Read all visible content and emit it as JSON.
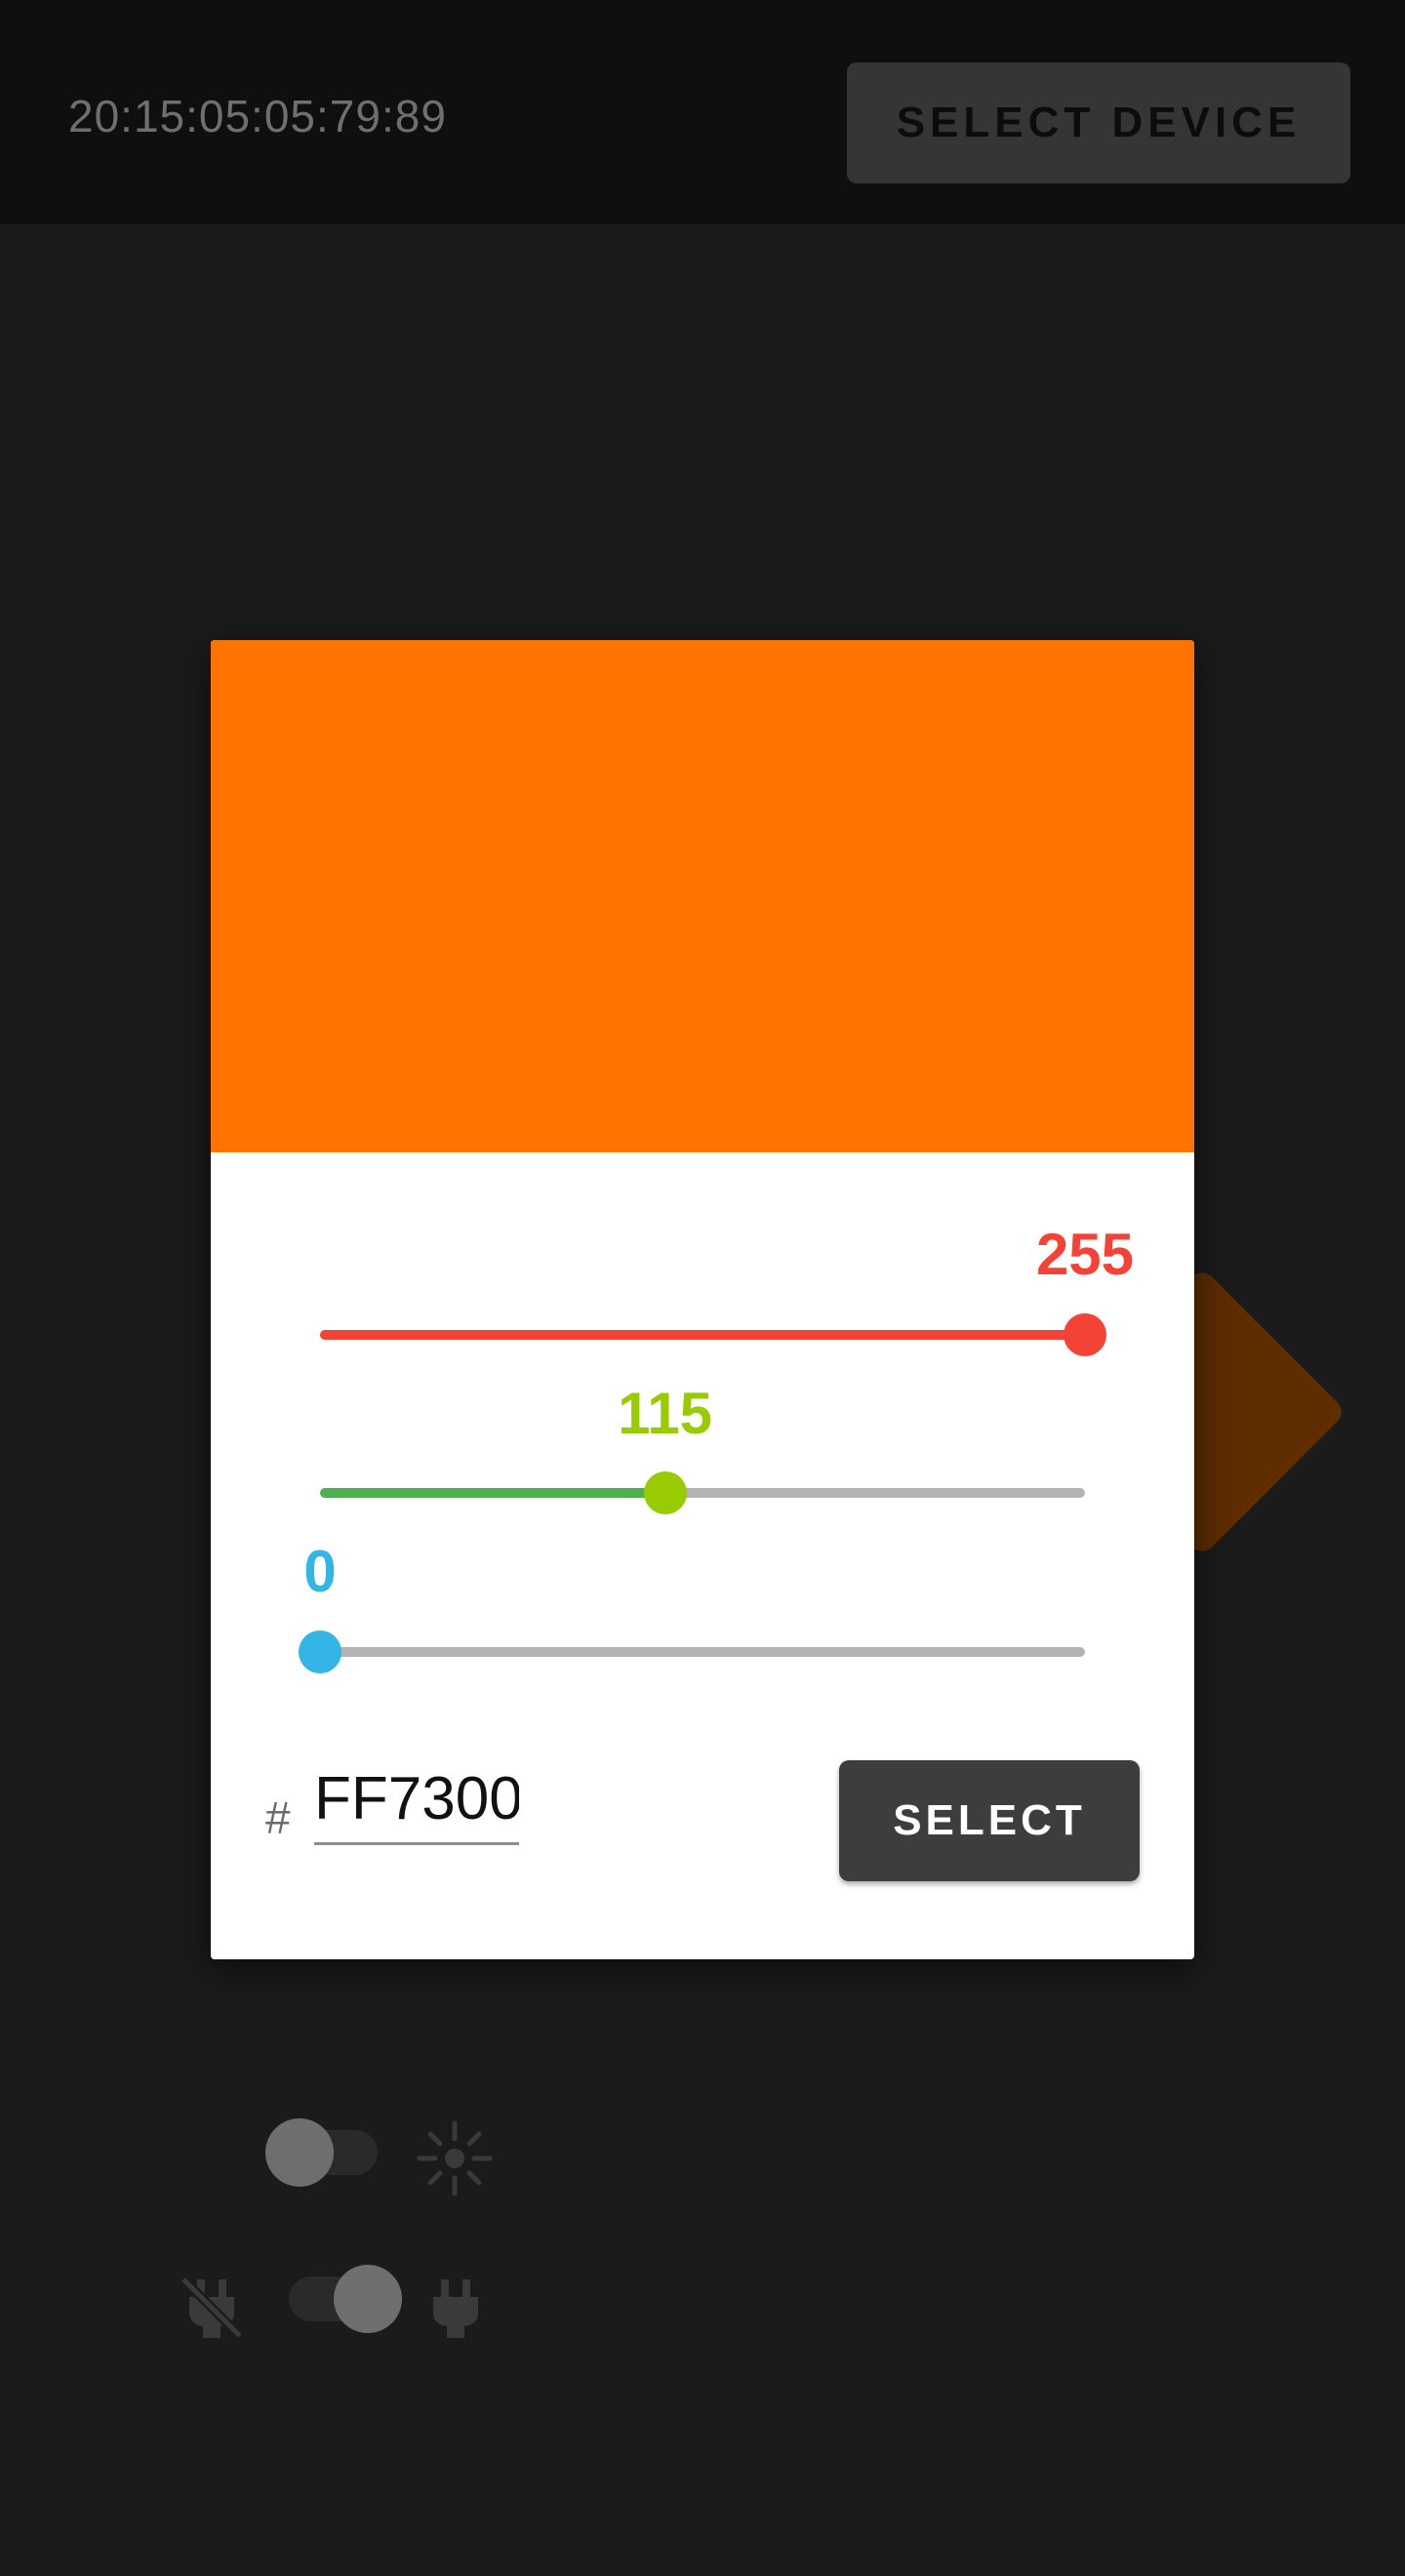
{
  "header": {
    "device_id": "20:15:05:05:79:89",
    "select_device_label": "SELECT DEVICE"
  },
  "background": {
    "diamond_colors": [
      "#5f0000",
      "#5e2d00"
    ],
    "light_toggle": {
      "on": false,
      "icon": "sun-icon"
    },
    "power_toggle": {
      "on": true,
      "icon_off": "plug-off-icon",
      "icon_on": "plug-icon"
    }
  },
  "color_picker": {
    "preview_color": "#FF7300",
    "red": {
      "value": "255",
      "fraction": 1.0,
      "color": "#F44336"
    },
    "green": {
      "value": "115",
      "fraction": 0.451,
      "color": "#99CC00",
      "fill_color": "#4CAF50"
    },
    "blue": {
      "value": "0",
      "fraction": 0.0,
      "color": "#33B5E5"
    },
    "hash_symbol": "#",
    "hex_value": "FF7300",
    "select_label": "SELECT"
  }
}
